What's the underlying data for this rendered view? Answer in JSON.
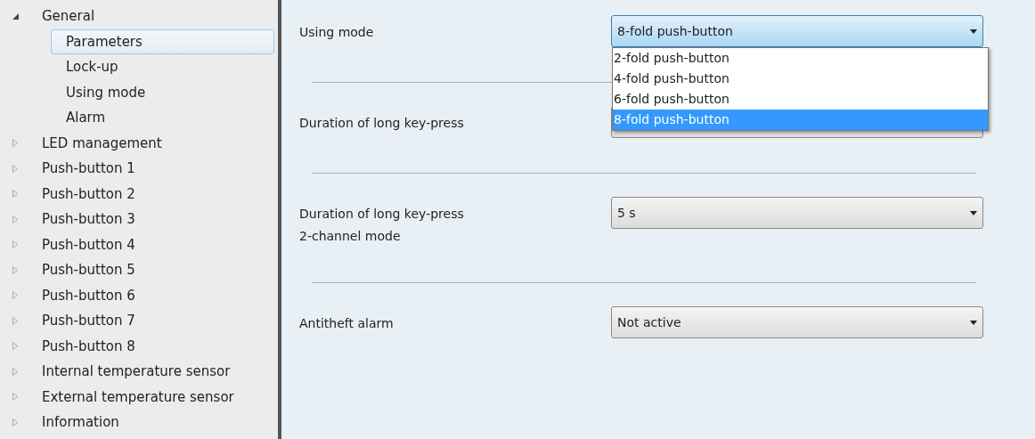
{
  "tree": [
    {
      "label": "General",
      "expanded": true,
      "selected": false,
      "children": [
        {
          "label": "Parameters",
          "selected": true
        },
        {
          "label": "Lock-up",
          "selected": false
        },
        {
          "label": "Using mode",
          "selected": false
        },
        {
          "label": "Alarm",
          "selected": false
        }
      ]
    },
    {
      "label": "LED management",
      "expanded": false,
      "selected": false
    },
    {
      "label": "Push-button 1",
      "expanded": false,
      "selected": false
    },
    {
      "label": "Push-button 2",
      "expanded": false,
      "selected": false
    },
    {
      "label": "Push-button 3",
      "expanded": false,
      "selected": false
    },
    {
      "label": "Push-button 4",
      "expanded": false,
      "selected": false
    },
    {
      "label": "Push-button 5",
      "expanded": false,
      "selected": false
    },
    {
      "label": "Push-button 6",
      "expanded": false,
      "selected": false
    },
    {
      "label": "Push-button 7",
      "expanded": false,
      "selected": false
    },
    {
      "label": "Push-button 8",
      "expanded": false,
      "selected": false
    },
    {
      "label": "Internal temperature sensor",
      "expanded": false,
      "selected": false
    },
    {
      "label": "External temperature sensor",
      "expanded": false,
      "selected": false
    },
    {
      "label": "Information",
      "expanded": false,
      "selected": false
    }
  ],
  "parameters": [
    {
      "label": [
        "Using mode"
      ],
      "value": "8-fold push-button",
      "open": true,
      "options": [
        {
          "label": "2-fold push-button",
          "selected": false
        },
        {
          "label": "4-fold push-button",
          "selected": false
        },
        {
          "label": "6-fold push-button",
          "selected": false
        },
        {
          "label": "8-fold push-button",
          "selected": true
        }
      ]
    },
    {
      "label": [
        "Duration of long key-press"
      ],
      "open": false
    },
    {
      "label": [
        "Duration of long key-press",
        "2-channel mode"
      ],
      "value": "5 s",
      "open": false
    },
    {
      "label": [
        "Antitheft alarm"
      ],
      "value": "Not active",
      "open": false
    }
  ]
}
